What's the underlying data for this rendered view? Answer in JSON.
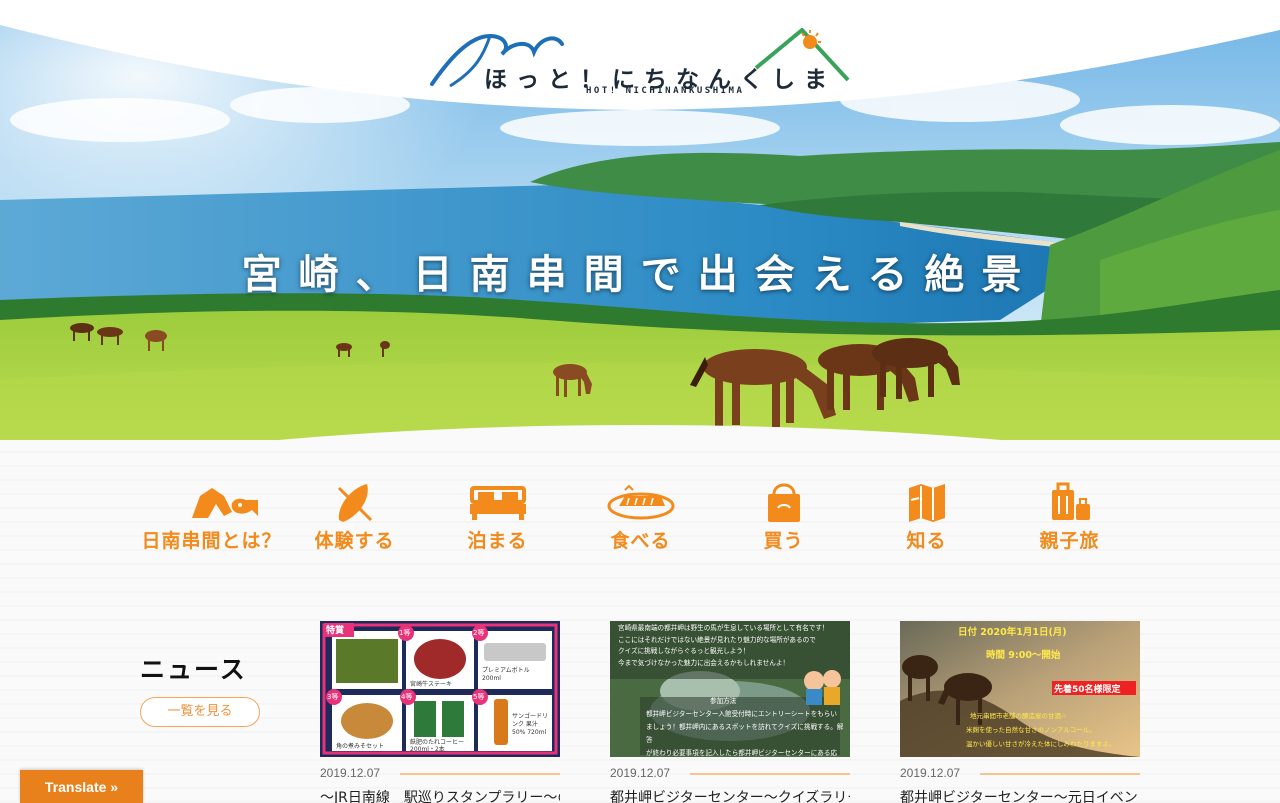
{
  "site": {
    "logo_text": "ほっと！にちなんくしま",
    "logo_sub": "HOT! NICHINANKUSHIMA"
  },
  "hero": {
    "catchphrase": "宮崎、日南串間で出会える絶景"
  },
  "categories": [
    {
      "label": "日南串間とは？",
      "icon": "horse-fish-icon"
    },
    {
      "label": "体験する",
      "icon": "surfboard-icon"
    },
    {
      "label": "泊まる",
      "icon": "bed-icon"
    },
    {
      "label": "食べる",
      "icon": "food-plate-icon"
    },
    {
      "label": "買う",
      "icon": "shopping-bag-icon"
    },
    {
      "label": "知る",
      "icon": "map-icon"
    },
    {
      "label": "親子旅",
      "icon": "suitcase-icon"
    }
  ],
  "news": {
    "heading": "ニュース",
    "more_label": "一覧を見る",
    "items": [
      {
        "date": "2019.12.07",
        "title": "〜JR日南線　駅巡りスタンプラリー〜の",
        "thumb": {
          "badges": [
            "特賞",
            "1等",
            "2等",
            "3等",
            "4等",
            "5等"
          ],
          "captions": [
            "宮崎牛ステーキ",
            "プレミアムボトル 200ml",
            "サンゴードリンク 果汁50% 720ml",
            "角の煮みそセット",
            "飫肥のたれコーヒー 200ml・2本"
          ]
        }
      },
      {
        "date": "2019.12.07",
        "title": "都井岬ビジターセンター〜クイズラリー",
        "thumb": {
          "lines": [
            "宮崎県最南端の都井岬は野生の馬が生息している場所として有名です！",
            "ここにはそれだけではない絶景が見れたり魅力的な場所があるので",
            "クイズに挑戦しながらぐるっと観光しよう！",
            "今まで気づけなかった魅力に出会えるかもしれませんよ！"
          ],
          "sub_heading": "参加方法",
          "sub_lines": [
            "都井岬ビジターセンター入館受付時にエントリーシートをもらい",
            "ましょう！都井岬内にあるスポットを訪れてクイズに挑戦する。解答",
            "が終わり必要事項を記入したら都井岬ビジターセンターにある応"
          ]
        }
      },
      {
        "date": "2019.12.07",
        "title": "都井岬ビジターセンター〜元日イベント",
        "thumb": {
          "date_line": "日付 2020年1月1日(月)",
          "time_line": "時間 9:00〜開始",
          "badge": "先着50名様限定",
          "lines": [
            "地元串間市老舗の醸造屋の甘酒☆",
            "米麹を使った自然な甘さのノンアルコール。",
            "温かい優しい甘さが冷えた体にしみわたりますよ。"
          ]
        }
      }
    ]
  },
  "translate_label": "Translate »",
  "colors": {
    "accent": "#f28a1c",
    "logo_wave": "#1e6fb8",
    "logo_roof": "#3aa35a",
    "sky": "#8ec8ea",
    "grass": "#8cc43a"
  }
}
